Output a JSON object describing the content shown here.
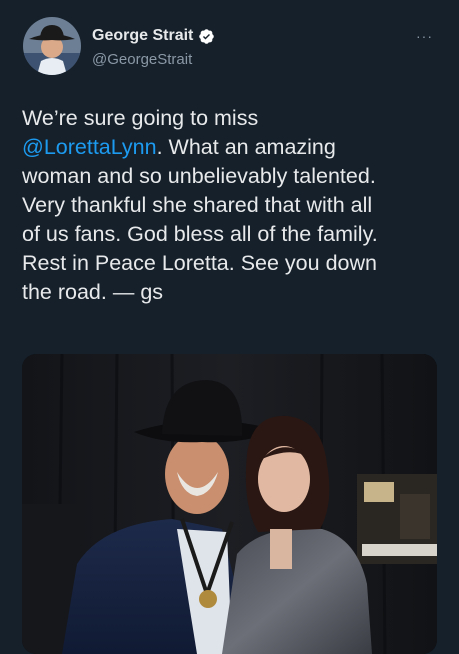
{
  "author": {
    "display_name": "George Strait",
    "handle": "@GeorgeStrait",
    "verified": true,
    "avatar_icon": "profile-photo-cowboy-hat"
  },
  "menu": {
    "more_label": "···",
    "more_icon": "more-options-icon"
  },
  "tweet": {
    "line_1": "We’re sure going to miss",
    "mention": "@LorettaLynn",
    "line_2_rest": ". What an amazing",
    "line_3": "woman and so unbelievably talented.",
    "line_4": "Very thankful she shared that with all",
    "line_5": "of us fans. God bless all of the family.",
    "line_6": "Rest in Peace Loretta. See you down",
    "line_7": "the road. — gs"
  },
  "media": {
    "type": "photo",
    "subject_icon": "photo-man-in-cowboy-hat-and-woman"
  },
  "colors": {
    "background": "#15202b",
    "text": "#e7e9ea",
    "secondary_text": "#8b98a5",
    "link": "#1d9bf0",
    "verified_badge": "#ffffff"
  }
}
